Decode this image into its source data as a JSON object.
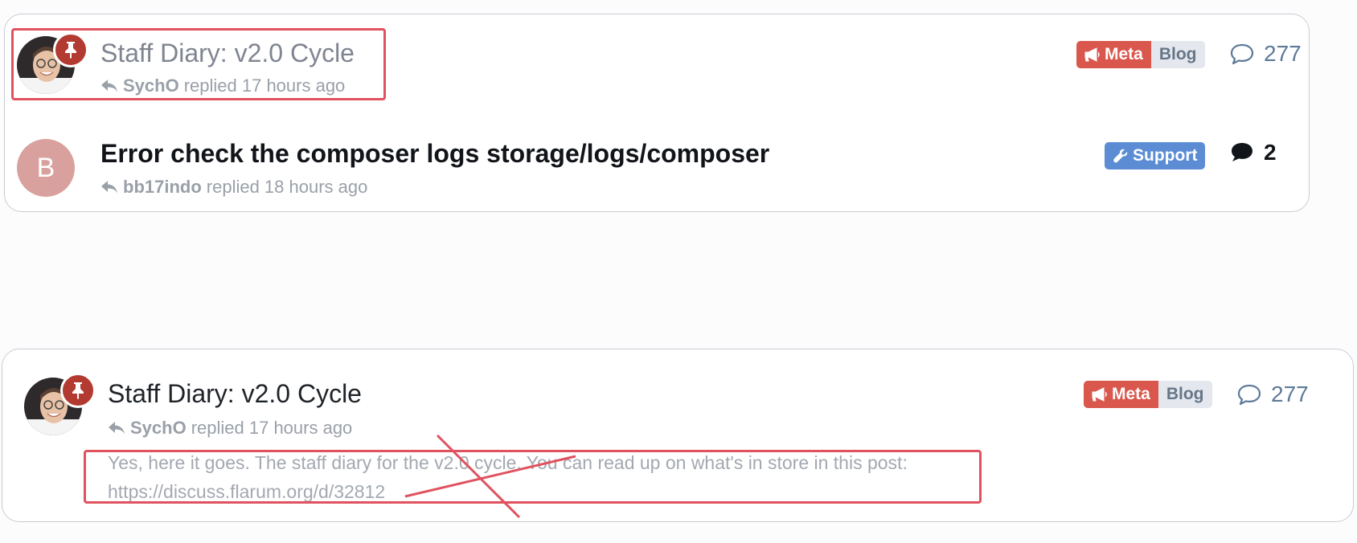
{
  "discussions": [
    {
      "title": "Staff Diary: v2.0 Cycle",
      "pinned": true,
      "avatar": "photo",
      "user": "SychO",
      "replied_text": "replied 17 hours ago",
      "tags": [
        {
          "label": "Meta",
          "icon": "megaphone-icon",
          "color": "#d9574d"
        },
        {
          "label": "Blog",
          "color": "#e4e7ee"
        }
      ],
      "reply_count": "277",
      "reply_icon": "comment-outline-icon"
    },
    {
      "title": "Error check the composer logs storage/logs/composer",
      "pinned": false,
      "avatar_letter": "B",
      "user": "bb17indo",
      "replied_text": "replied 18 hours ago",
      "tags": [
        {
          "label": "Support",
          "icon": "wrench-icon",
          "color": "#5c8dd4"
        }
      ],
      "reply_count": "2",
      "reply_icon": "comment-solid-icon"
    }
  ],
  "expanded_discussion": {
    "title": "Staff Diary: v2.0 Cycle",
    "pinned": true,
    "avatar": "photo",
    "user": "SychO",
    "replied_text": "replied 17 hours ago",
    "tags": [
      {
        "label": "Meta",
        "icon": "megaphone-icon",
        "color": "#d9574d"
      },
      {
        "label": "Blog",
        "color": "#e4e7ee"
      }
    ],
    "reply_count": "277",
    "reply_icon": "comment-outline-icon",
    "excerpt": "Yes, here it goes. The staff diary for the v2.0 cycle. You can read up on what's in store in this post: https://discuss.flarum.org/d/32812"
  },
  "annotation_color": "#e0525f"
}
